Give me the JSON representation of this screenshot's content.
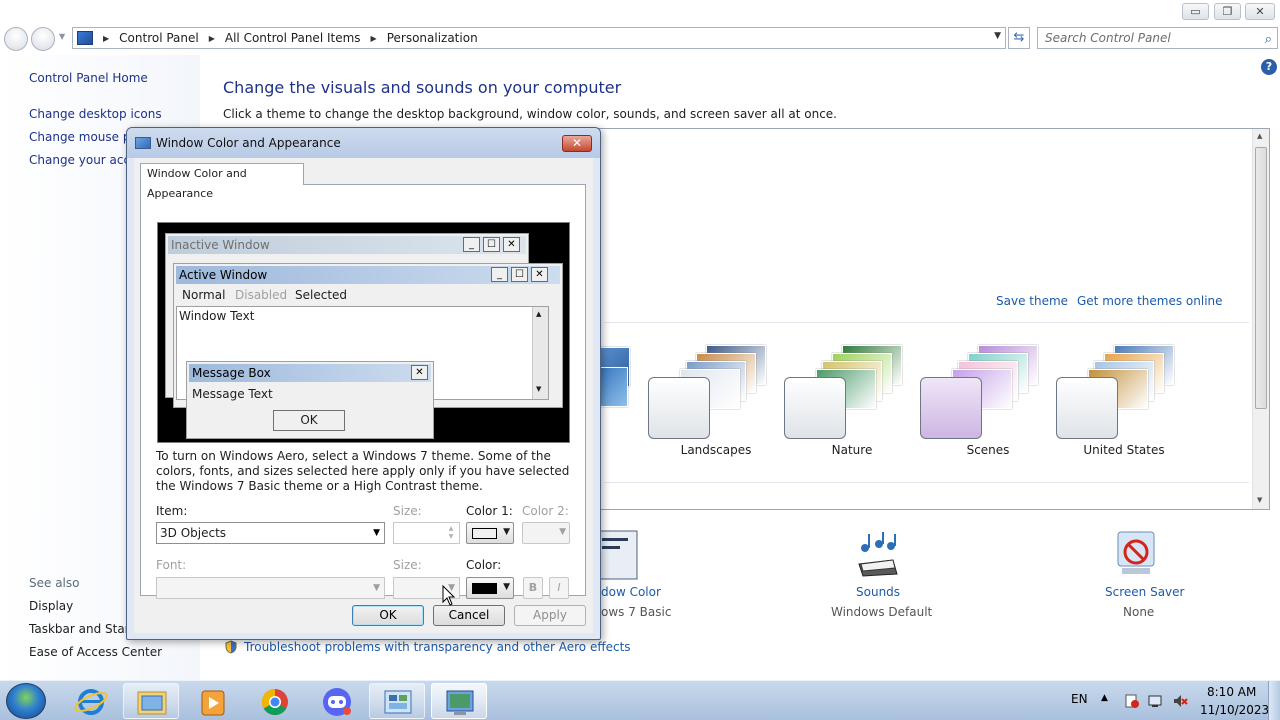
{
  "window": {
    "controls": {
      "minimize": "▭",
      "maximize": "❐",
      "close": "✕"
    }
  },
  "address": {
    "crumbs": [
      "Control Panel",
      "All Control Panel Items",
      "Personalization"
    ],
    "search_placeholder": "Search Control Panel"
  },
  "sidebar": {
    "home": "Control Panel Home",
    "links": [
      "Change desktop icons",
      "Change mouse po",
      "Change your acco"
    ],
    "see_also_label": "See also",
    "see_also": [
      "Display",
      "Taskbar and Start I",
      "Ease of Access Center"
    ]
  },
  "main": {
    "title": "Change the visuals and sounds on your computer",
    "subtitle": "Click a theme to change the desktop background, window color, sounds, and screen saver all at once.",
    "save_theme": "Save theme",
    "get_more_themes": "Get more themes online",
    "themes": [
      {
        "name": "Landscapes",
        "colors": [
          "#3d5a8a",
          "#c98a4a",
          "#7a9bc8",
          "#dfe6ef"
        ]
      },
      {
        "name": "Nature",
        "colors": [
          "#2f7a3a",
          "#9bd15a",
          "#d3c26a",
          "#4a9a6a"
        ]
      },
      {
        "name": "Scenes",
        "colors": [
          "#b78bd8",
          "#7fd0c9",
          "#f3c1d9",
          "#c3a0e8"
        ]
      },
      {
        "name": "United States",
        "colors": [
          "#4a7ab8",
          "#e6a24a",
          "#a6c4e6",
          "#c2903a"
        ]
      }
    ],
    "bottom": {
      "window_color_title": "dow Color",
      "window_color_sub": "ows 7 Basic",
      "sounds_title": "Sounds",
      "sounds_sub": "Windows Default",
      "screensaver_title": "Screen Saver",
      "screensaver_sub": "None"
    },
    "troubleshoot": "Troubleshoot problems with transparency and other Aero effects"
  },
  "dialog": {
    "title": "Window Color and Appearance",
    "tab": "Window Color and Appearance",
    "preview": {
      "inactive_window": "Inactive Window",
      "active_window": "Active Window",
      "menu_normal": "Normal",
      "menu_disabled": "Disabled",
      "menu_selected": "Selected",
      "window_text": "Window Text",
      "message_box": "Message Box",
      "message_text": "Message Text",
      "ok": "OK"
    },
    "info": "To turn on Windows Aero, select a Windows 7 theme.  Some of the colors, fonts, and sizes selected here apply only if you have selected the Windows 7 Basic theme or a High Contrast theme.",
    "item_label": "Item:",
    "item_value": "3D Objects",
    "size_label": "Size:",
    "color1_label": "Color 1:",
    "color2_label": "Color 2:",
    "color1_swatch": "#f0f0f0",
    "font_label": "Font:",
    "font_size_label": "Size:",
    "color_label": "Color:",
    "font_color_swatch": "#000000",
    "bold": "B",
    "italic": "I",
    "ok": "OK",
    "cancel": "Cancel",
    "apply": "Apply"
  },
  "taskbar": {
    "apps": [
      "start-orb",
      "internet-explorer-icon",
      "file-explorer-icon",
      "media-player-icon",
      "chrome-icon",
      "discord-icon",
      "control-panel-icon",
      "personalization-icon"
    ],
    "lang": "EN",
    "time": "8:10 AM",
    "date": "11/10/2023"
  }
}
